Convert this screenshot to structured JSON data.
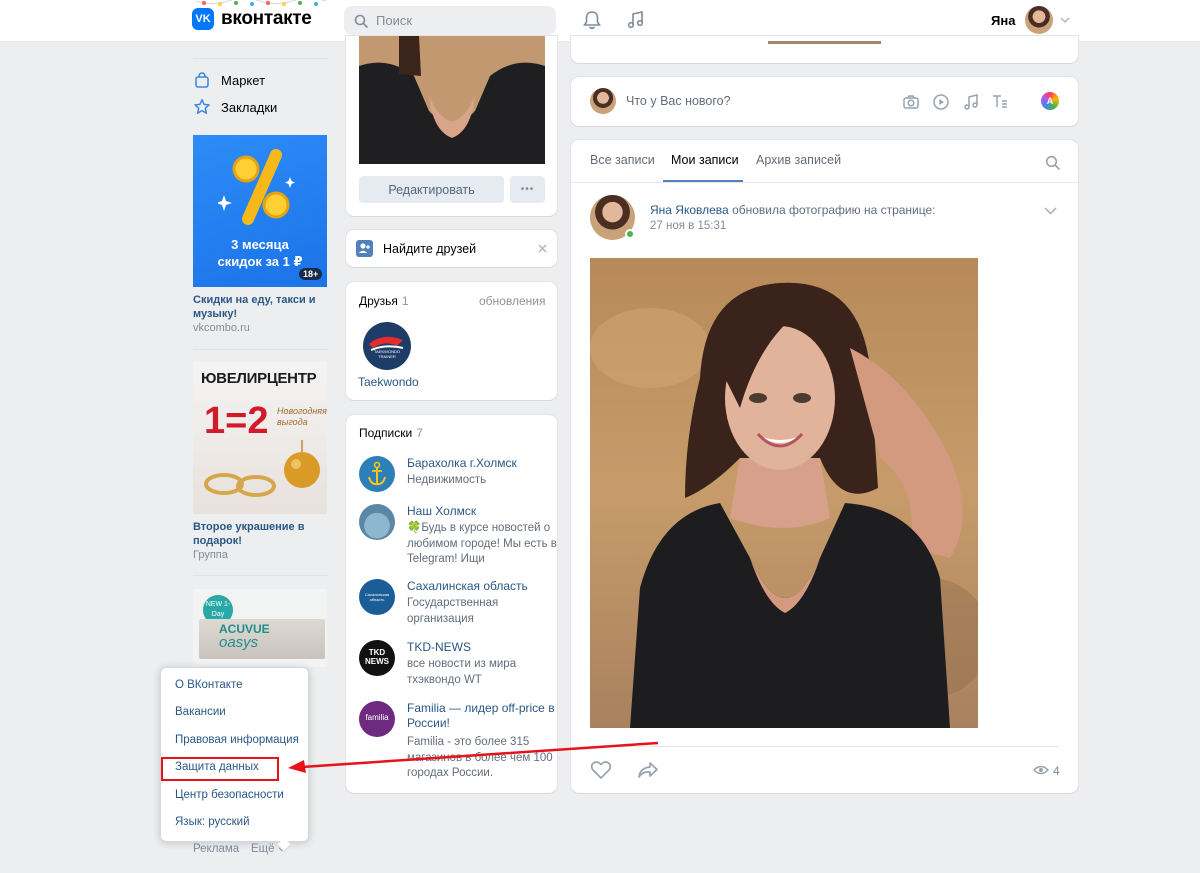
{
  "header": {
    "logo_text": "вконтакте",
    "logo_mark": "VK",
    "search_placeholder": "Поиск",
    "user_name": "Яна"
  },
  "left_menu": {
    "items": [
      {
        "label": "Маркет",
        "icon": "shopping-bag-icon"
      },
      {
        "label": "Закладки",
        "icon": "star-icon"
      }
    ]
  },
  "ads": [
    {
      "banner_lines": [
        "3 месяца",
        "скидок за 1 ₽"
      ],
      "age_badge": "18+",
      "caption": "Скидки на еду, такси и музыку!",
      "sub": "vkcombo.ru"
    },
    {
      "banner_brand": "ЮВЕЛИРЦЕНТР",
      "banner_offer": "1=2",
      "banner_tag": "Новогодняя выгода",
      "caption": "Второе украшение в подарок!",
      "sub": "Группа"
    },
    {
      "banner_tag": "NEW 1-Day",
      "banner_brand": "ACUVUE",
      "banner_product": "oasys"
    }
  ],
  "footer_links": {
    "ads": "Реклама",
    "more": "Ещё"
  },
  "dropdown": {
    "items": [
      "О ВКонтакте",
      "Вакансии",
      "Правовая информация",
      "Защита данных",
      "Центр безопасности",
      "Язык: русский"
    ],
    "highlighted": "Защита данных"
  },
  "profile": {
    "edit_button": "Редактировать",
    "more_button": "•••"
  },
  "find_friends": {
    "label": "Найдите друзей"
  },
  "friends": {
    "title": "Друзья",
    "count": "1",
    "updates": "обновления",
    "items": [
      {
        "name": "Taekwondo",
        "logo_text": "TAEKWONDO TRAINER"
      }
    ]
  },
  "subscriptions": {
    "title": "Подписки",
    "count": "7",
    "items": [
      {
        "name": "Барахолка г.Холмск",
        "desc": "Недвижимость"
      },
      {
        "name": "Наш Холмск",
        "desc": "🍀Будь в курсе новостей о любимом городе! Мы есть в Telegram! Ищи"
      },
      {
        "name": "Сахалинская область",
        "desc": "Государственная организация",
        "logo_text": "Сахалинская область"
      },
      {
        "name": "TKD-NEWS",
        "desc": "все новости из мира тхэквондо WT",
        "logo_text": "TKD NEWS"
      },
      {
        "name": "Familia — лидер off-price в России!",
        "desc": "Familia - это более 315 магазинов в более чем 100 городах России.",
        "logo_text": "familia"
      }
    ]
  },
  "composer": {
    "placeholder": "Что у Вас нового?"
  },
  "wall": {
    "tabs": [
      "Все записи",
      "Мои записи",
      "Архив записей"
    ],
    "active_tab": "Мои записи"
  },
  "post": {
    "author": "Яна Яковлева",
    "action": "обновила фотографию на странице:",
    "date": "27 ноя в 15:31",
    "views": "4"
  },
  "colors": {
    "accent": "#0077ff",
    "link": "#2a5885",
    "highlight": "#e8121b",
    "online": "#4bb34b"
  }
}
